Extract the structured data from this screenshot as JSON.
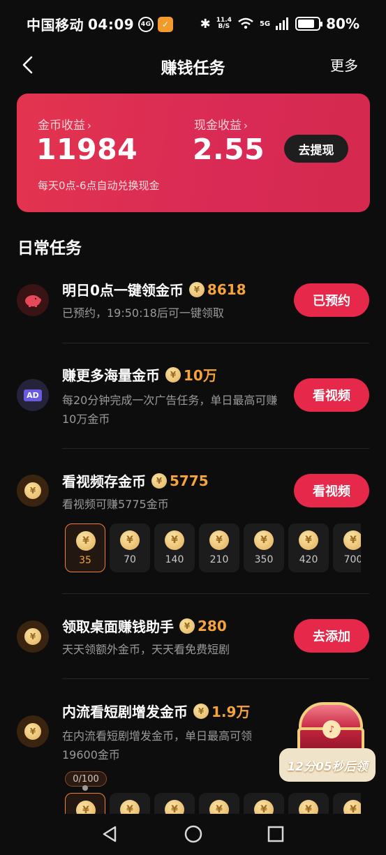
{
  "status_bar": {
    "carrier": "中国移动",
    "time": "04:09",
    "badge": "4G",
    "net_speed_top": "11.4",
    "net_speed_bottom": "B/S",
    "signal": "5G",
    "battery": "80%",
    "battery_level": 0.8
  },
  "header": {
    "title": "赚钱任务",
    "more": "更多"
  },
  "earnings": {
    "coin_label": "金币收益",
    "coin_value": "11984",
    "cash_label": "现金收益",
    "cash_value": "2.55",
    "withdraw_label": "去提现",
    "note": "每天0点-6点自动兑换现金"
  },
  "section_title": "日常任务",
  "tasks": [
    {
      "icon": "piggy-bank-icon",
      "title": "明日0点一键领金币",
      "reward": "8618",
      "desc": "已预约，19:50:18后可一键领取",
      "button": "已预约"
    },
    {
      "icon": "ad-icon",
      "icon_text": "AD",
      "title": "赚更多海量金币",
      "reward": "10万",
      "desc": "每20分钟完成一次广告任务，单日最高可赚10万金币",
      "button": "看视频"
    },
    {
      "icon": "yen-coin-icon",
      "title": "看视频存金币",
      "reward": "5775",
      "desc": "看视频可赚5775金币",
      "button": "看视频",
      "coins": [
        "35",
        "70",
        "140",
        "210",
        "350",
        "420",
        "700"
      ]
    },
    {
      "icon": "yen-coin-icon",
      "title": "领取桌面赚钱助手",
      "reward": "280",
      "desc": "天天领额外金币，天天看免费短剧",
      "button": "去添加"
    },
    {
      "icon": "yen-coin-icon",
      "title": "内流看短剧增发金币",
      "reward": "1.9万",
      "desc": "在内流看短剧增发金币，单日最高可领19600金币",
      "progress": "0/100"
    }
  ],
  "floating_widget": {
    "timer": "12分05秒后领"
  },
  "colors": {
    "accent": "#e6284a",
    "reward": "#f5a33a",
    "card_start": "#e3344f",
    "card_end": "#d6294e"
  }
}
